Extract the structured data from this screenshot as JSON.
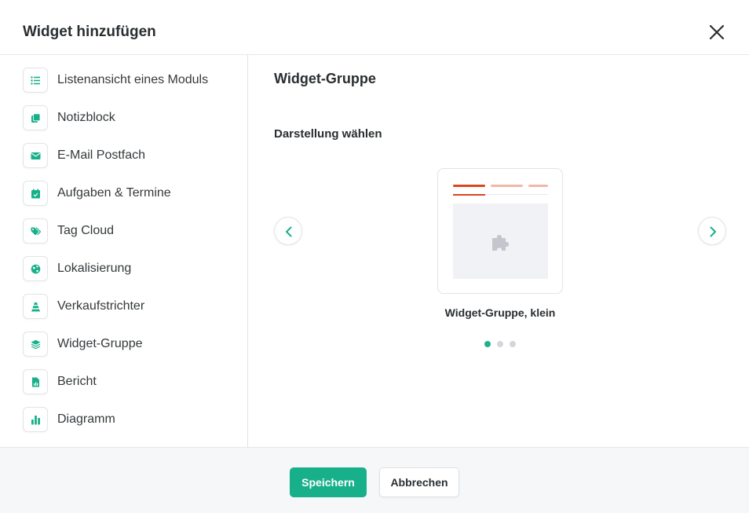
{
  "dialog": {
    "title": "Widget hinzufügen",
    "close_icon": "close-icon"
  },
  "colors": {
    "accent": "#17b08a",
    "active_tab": "#d9471c",
    "inactive_tab": "#f0b8a7"
  },
  "sidebar": {
    "items": [
      {
        "label": "Listenansicht eines Moduls",
        "icon": "list-icon"
      },
      {
        "label": "Notizblock",
        "icon": "notes-icon"
      },
      {
        "label": "E-Mail Postfach",
        "icon": "envelope-icon"
      },
      {
        "label": "Aufgaben & Termine",
        "icon": "calendar-check-icon"
      },
      {
        "label": "Tag Cloud",
        "icon": "tags-icon"
      },
      {
        "label": "Lokalisierung",
        "icon": "globe-icon"
      },
      {
        "label": "Verkaufstrichter",
        "icon": "funnel-icon"
      },
      {
        "label": "Widget-Gruppe",
        "icon": "layers-icon"
      },
      {
        "label": "Bericht",
        "icon": "report-file-icon"
      },
      {
        "label": "Diagramm",
        "icon": "bar-chart-icon"
      }
    ]
  },
  "main": {
    "title": "Widget-Gruppe",
    "subtitle": "Darstellung wählen",
    "carousel": {
      "caption": "Widget-Gruppe, klein",
      "slide_count": 3,
      "active_index": 0,
      "prev_icon": "chevron-left-icon",
      "next_icon": "chevron-right-icon",
      "preview_icon": "puzzle-icon"
    }
  },
  "footer": {
    "save_label": "Speichern",
    "cancel_label": "Abbrechen"
  }
}
